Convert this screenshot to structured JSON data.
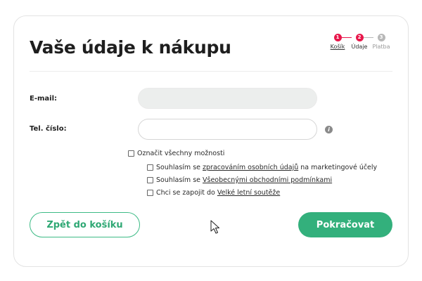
{
  "page": {
    "title": "Vaše údaje k nákupu"
  },
  "stepper": {
    "steps": [
      {
        "number": "1",
        "label": "Košík",
        "state": "done"
      },
      {
        "number": "2",
        "label": "Údaje",
        "state": "current"
      },
      {
        "number": "3",
        "label": "Platba",
        "state": "upcoming"
      }
    ],
    "active_color": "#e8174b",
    "inactive_color": "#b8b8b8"
  },
  "form": {
    "email_label": "E-mail:",
    "email_value": "",
    "phone_label": "Tel. číslo:",
    "phone_value": "",
    "info_icon": "info-icon"
  },
  "consents": {
    "select_all": {
      "label": "Označit všechny možnosti",
      "checked": false
    },
    "items": [
      {
        "prefix": "Souhlasím se",
        "link": "zpracováním osobních údajů",
        "suffix": "na marketingové účely",
        "checked": false
      },
      {
        "prefix": "Souhlasím se",
        "link": "Všeobecnými obchodními podmínkami",
        "suffix": "",
        "checked": false
      },
      {
        "prefix": "Chci se zapojit do",
        "link": "Velké letní soutěže",
        "suffix": "",
        "checked": false
      }
    ]
  },
  "actions": {
    "back_label": "Zpět do košíku",
    "continue_label": "Pokračovat",
    "accent_color": "#33b07c"
  }
}
